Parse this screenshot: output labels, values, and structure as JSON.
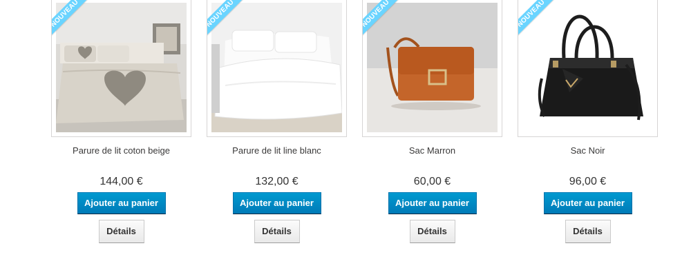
{
  "ribbon_label": "NOUVEAU",
  "currency_note": "€",
  "products": [
    {
      "name": "Parure de lit coton beige",
      "price": "144,00 €",
      "cart_label": "Ajouter au panier",
      "details_label": "Détails"
    },
    {
      "name": "Parure de lit line blanc",
      "price": "132,00 €",
      "cart_label": "Ajouter au panier",
      "details_label": "Détails"
    },
    {
      "name": "Sac Marron",
      "price": "60,00 €",
      "cart_label": "Ajouter au panier",
      "details_label": "Détails"
    },
    {
      "name": "Sac Noir",
      "price": "96,00 €",
      "cart_label": "Ajouter au panier",
      "details_label": "Détails"
    }
  ],
  "colors": {
    "ribbon": "#6ad4ff",
    "cart_button": "#0089c7",
    "details_button": "#efefef"
  }
}
